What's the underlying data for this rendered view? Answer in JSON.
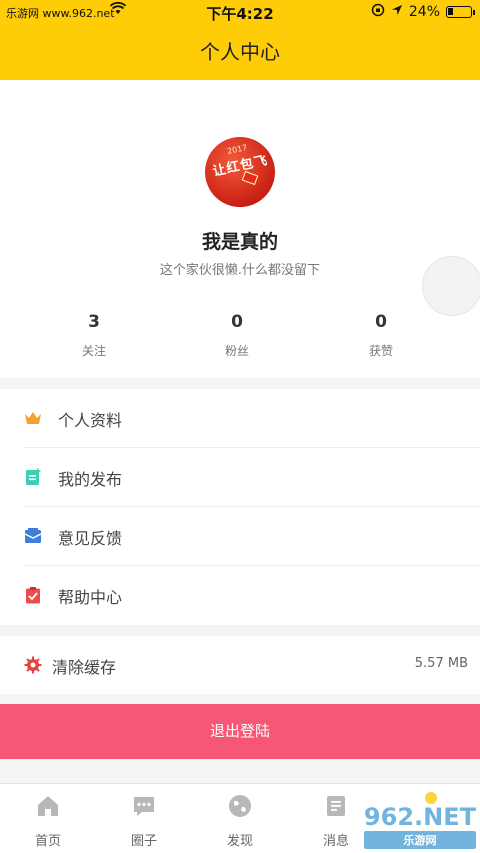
{
  "status_bar": {
    "carrier": "乐游网 www.962.net",
    "time": "下午4:22",
    "battery_percent": "24%",
    "battery_level": 0.24
  },
  "header": {
    "title": "个人中心"
  },
  "profile": {
    "avatar_text": "让红包飞",
    "avatar_year": "2017",
    "nickname": "我是真的",
    "bio": "这个家伙很懒.什么都没留下",
    "stats": [
      {
        "value": "3",
        "label": "关注"
      },
      {
        "value": "0",
        "label": "粉丝"
      },
      {
        "value": "0",
        "label": "获赞"
      }
    ]
  },
  "menu": {
    "items": [
      {
        "label": "个人资料",
        "icon": "crown-icon",
        "color": "#f4a12d"
      },
      {
        "label": "我的发布",
        "icon": "document-add-icon",
        "color": "#3ccfb4"
      },
      {
        "label": "意见反馈",
        "icon": "mail-icon",
        "color": "#3f7fd9"
      },
      {
        "label": "帮助中心",
        "icon": "clipboard-check-icon",
        "color": "#ee4b4b"
      }
    ]
  },
  "cache": {
    "label": "清除缓存",
    "size": "5.57 MB",
    "icon": "gear-icon",
    "color": "#e84242"
  },
  "logout": {
    "label": "退出登陆",
    "color": "#f55775"
  },
  "tabbar": {
    "tabs": [
      {
        "label": "首页",
        "icon": "home-icon"
      },
      {
        "label": "圈子",
        "icon": "chat-icon"
      },
      {
        "label": "发现",
        "icon": "globe-icon"
      },
      {
        "label": "消息",
        "icon": "message-icon"
      }
    ]
  },
  "watermark": {
    "text": "962",
    "suffix": ".NET",
    "sub": "乐游网"
  },
  "colors": {
    "accent": "#fecd07",
    "logout": "#f55775",
    "background": "#f4f4f4"
  }
}
